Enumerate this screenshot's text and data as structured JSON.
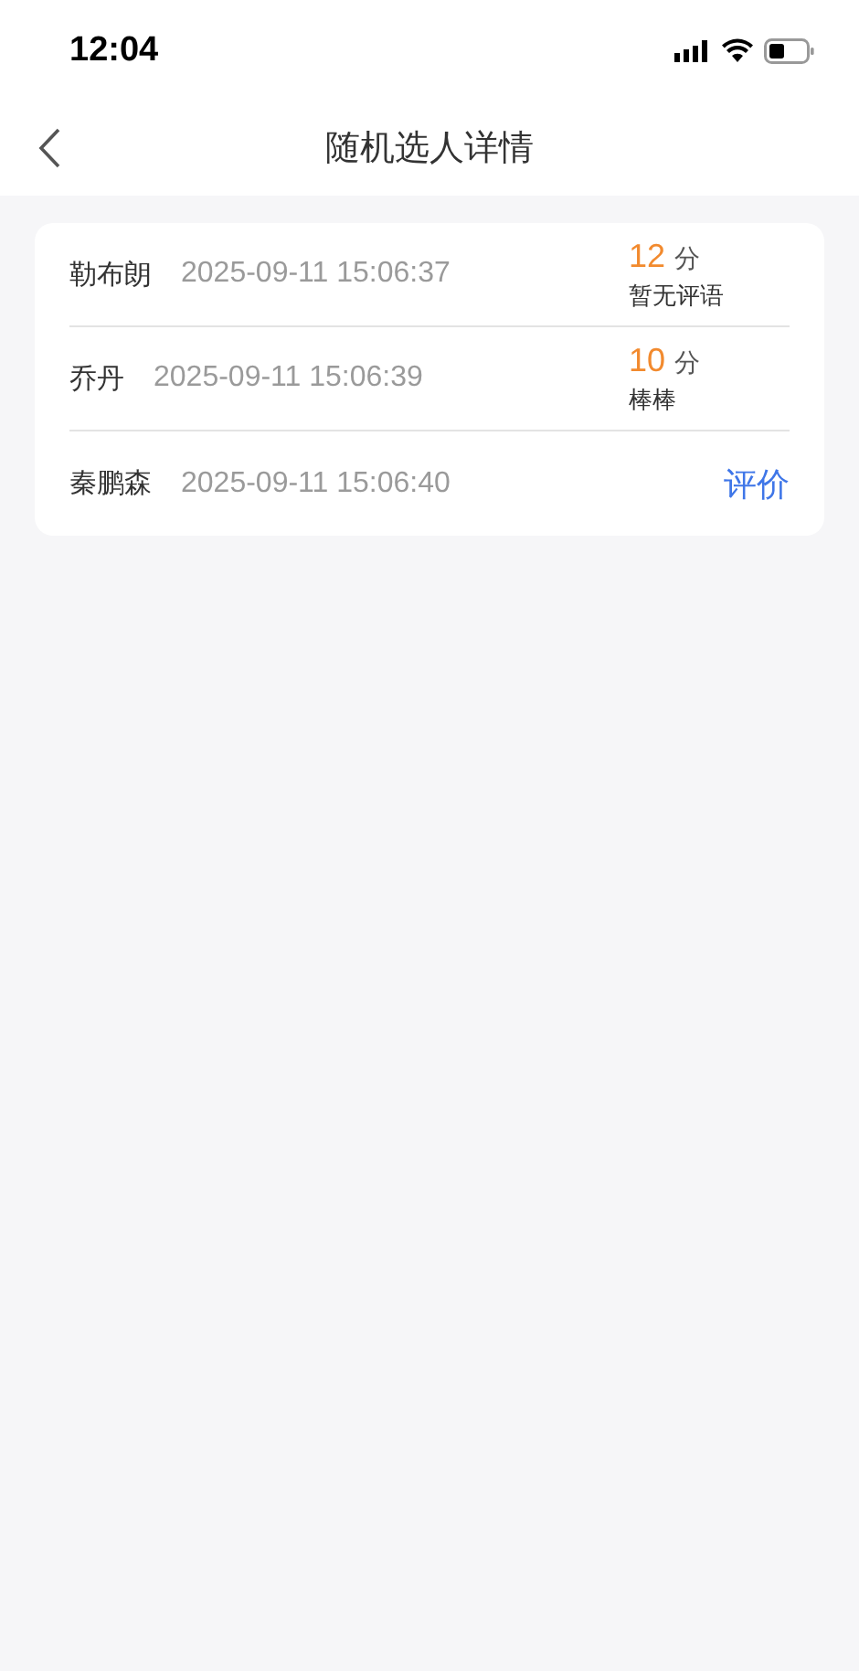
{
  "status_bar": {
    "time": "12:04"
  },
  "nav": {
    "title": "随机选人详情"
  },
  "records": [
    {
      "kind": "scored",
      "name": "勒布朗",
      "time": "2025-09-11 15:06:37",
      "score": "12",
      "unit": "分",
      "comment": "暂无评语"
    },
    {
      "kind": "scored",
      "name": "乔丹",
      "time": "2025-09-11 15:06:39",
      "score": "10",
      "unit": "分",
      "comment": "棒棒"
    },
    {
      "kind": "unrated",
      "name": "秦鹏森",
      "time": "2025-09-11 15:06:40",
      "action": "评价"
    }
  ]
}
